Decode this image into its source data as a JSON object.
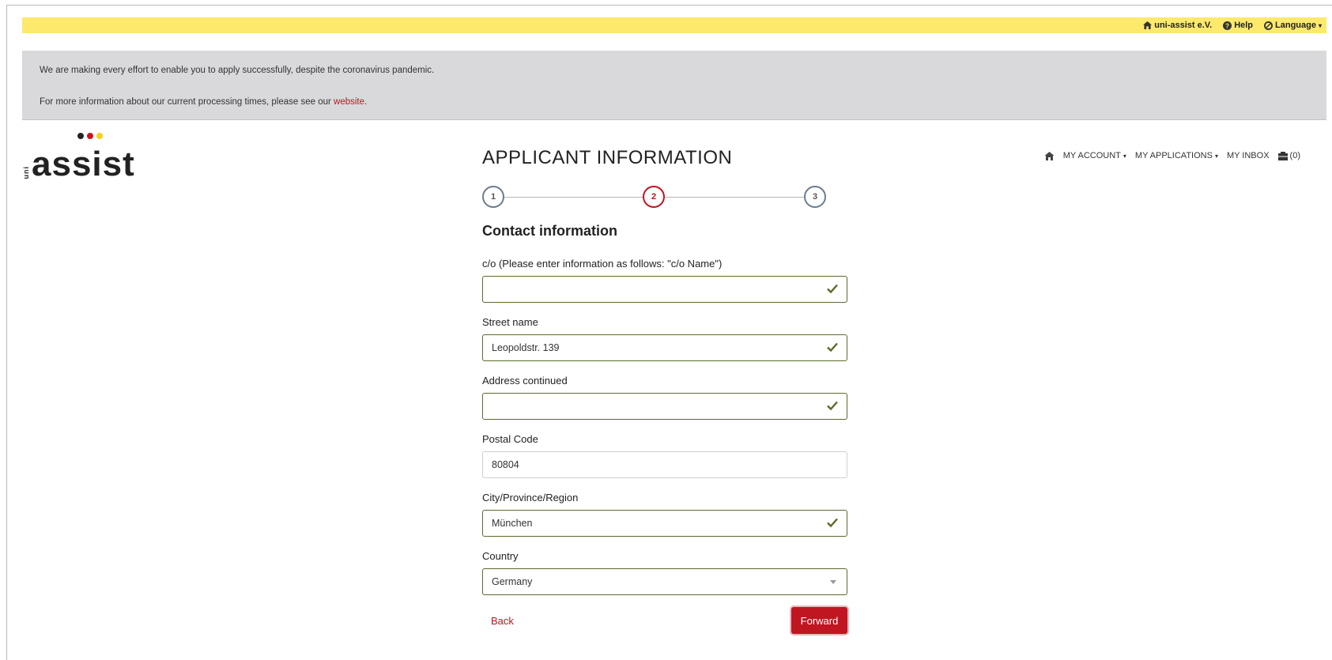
{
  "topbar": {
    "org_label": "uni-assist e.V.",
    "help_label": "Help",
    "language_label": "Language"
  },
  "notice": {
    "line1": "We are making every effort to enable you to apply successfully, despite the coronavirus pandemic.",
    "line2_prefix": "For more information about our current processing times, please see our ",
    "line2_link": "website",
    "line2_suffix": "."
  },
  "logo": {
    "small": "uni",
    "word": "assist"
  },
  "nav": {
    "my_account": "MY ACCOUNT",
    "my_applications": "MY APPLICATIONS",
    "my_inbox": "MY INBOX",
    "cart_count": "(0)"
  },
  "page": {
    "title": "APPLICANT INFORMATION",
    "section_title": "Contact information"
  },
  "stepper": {
    "steps": [
      "1",
      "2",
      "3"
    ],
    "active_step": 2
  },
  "form": {
    "co": {
      "label": "c/o (Please enter information as follows: \"c/o Name\")",
      "value": ""
    },
    "street": {
      "label": "Street name",
      "value": "Leopoldstr. 139"
    },
    "address_continued": {
      "label": "Address continued",
      "value": ""
    },
    "postal_code": {
      "label": "Postal Code",
      "value": "80804"
    },
    "city": {
      "label": "City/Province/Region",
      "value": "München"
    },
    "country": {
      "label": "Country",
      "value": "Germany"
    }
  },
  "actions": {
    "back_label": "Back",
    "forward_label": "Forward"
  },
  "colors": {
    "accent_red": "#c1121f",
    "topbar_yellow": "#fde96c",
    "valid_green": "#5b6b2a"
  }
}
